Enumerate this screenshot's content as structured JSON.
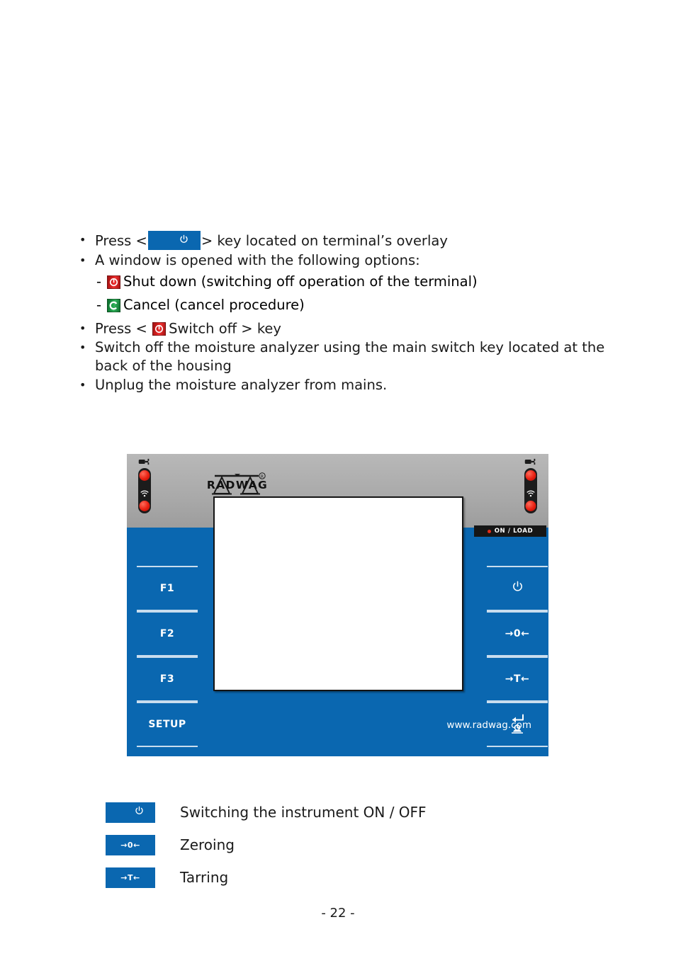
{
  "document": {
    "page_number": "- 22 -"
  },
  "instructions": {
    "items": [
      {
        "id": "press-power-key",
        "bullet": "•",
        "text_before": "Press <",
        "has_inline_key": true,
        "inline_key_icon": "power-icon",
        "text_after": "> key located on terminal’s overlay"
      },
      {
        "id": "window-opened",
        "bullet": "•",
        "text": "A window is opened with the following options:"
      },
      {
        "id": "press-switch-off",
        "bullet": "•",
        "text_before": " Press < ",
        "has_inline_icon": true,
        "inline_icon": "shutdown-icon",
        "text_after": "Switch off > key"
      },
      {
        "id": "main-switch",
        "bullet": "•",
        "text": "Switch off the moisture analyzer using the main switch key located at the back of the housing"
      },
      {
        "id": "unplug",
        "bullet": "•",
        "text": "Unplug the moisture analyzer from mains."
      }
    ],
    "sub_options": [
      {
        "dash": "-",
        "icon": "shutdown-icon",
        "text": "Shut down (switching off operation of the terminal)"
      },
      {
        "dash": "-",
        "icon": "cancel-icon",
        "text": "Cancel (cancel procedure)"
      }
    ]
  },
  "terminal": {
    "brand": "RADWAG",
    "brand_mark": "®",
    "website": "www.radwag.com",
    "status_indicator": {
      "label": "ON / LOAD",
      "led_color": "#e22b18"
    },
    "left_keys": [
      {
        "label": "F1",
        "name": "f1-key"
      },
      {
        "label": "F2",
        "name": "f2-key"
      },
      {
        "label": "F3",
        "name": "f3-key"
      },
      {
        "label": "SETUP",
        "name": "setup-key"
      }
    ],
    "right_keys": [
      {
        "label": "",
        "icon": "power-icon",
        "name": "power-key"
      },
      {
        "label": "→0←",
        "icon": "zero-icon",
        "name": "zero-key"
      },
      {
        "label": "→T←",
        "icon": "tare-icon",
        "name": "tare-key"
      },
      {
        "label": "",
        "icon": "enter-print-icon",
        "name": "enter-print-key"
      }
    ]
  },
  "legend": {
    "rows": [
      {
        "key_icon": "power-icon",
        "key_label": "",
        "description": "Switching the instrument ON / OFF"
      },
      {
        "key_icon": "zero-icon",
        "key_label": "→0←",
        "description": "Zeroing"
      },
      {
        "key_icon": "tare-icon",
        "key_label": "→T←",
        "description": "Tarring"
      }
    ]
  },
  "colors": {
    "key_blue": "#0a67b0",
    "panel_grey": "#a9a9a9",
    "led_red": "#e22b18",
    "shutdown_red": "#d61f1f",
    "cancel_green": "#1d9a46"
  }
}
